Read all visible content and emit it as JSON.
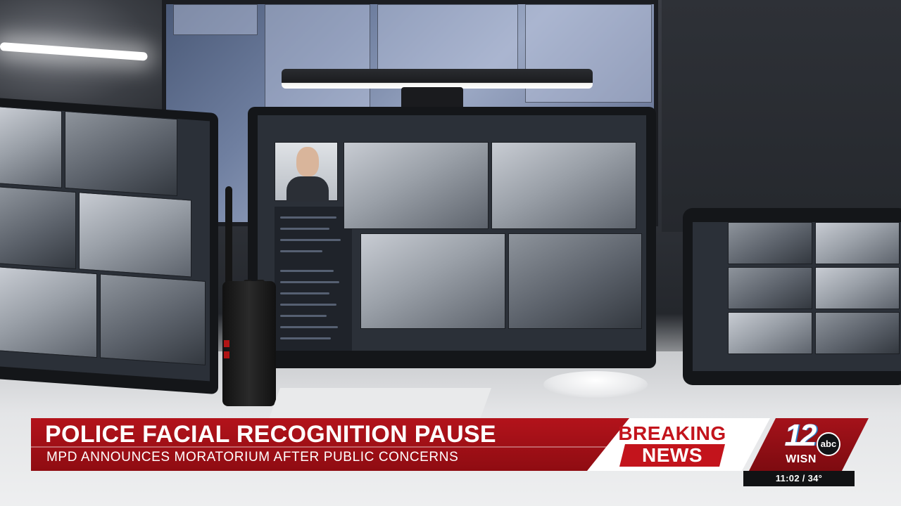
{
  "lower_third": {
    "headline": "POLICE FACIAL RECOGNITION PAUSE",
    "subhead": "MPD ANNOUNCES MORATORIUM AFTER PUBLIC CONCERNS"
  },
  "breaking": {
    "line1": "BREAKING",
    "line2": "NEWS"
  },
  "station": {
    "channel_number": "12",
    "network": "abc",
    "call_letters": "WISN"
  },
  "ticker": {
    "time_temp": "11:02 / 34°"
  },
  "colors": {
    "banner_red": "#b3131b",
    "breaking_red": "#c3141c",
    "logo_blue": "#2b79c2"
  }
}
